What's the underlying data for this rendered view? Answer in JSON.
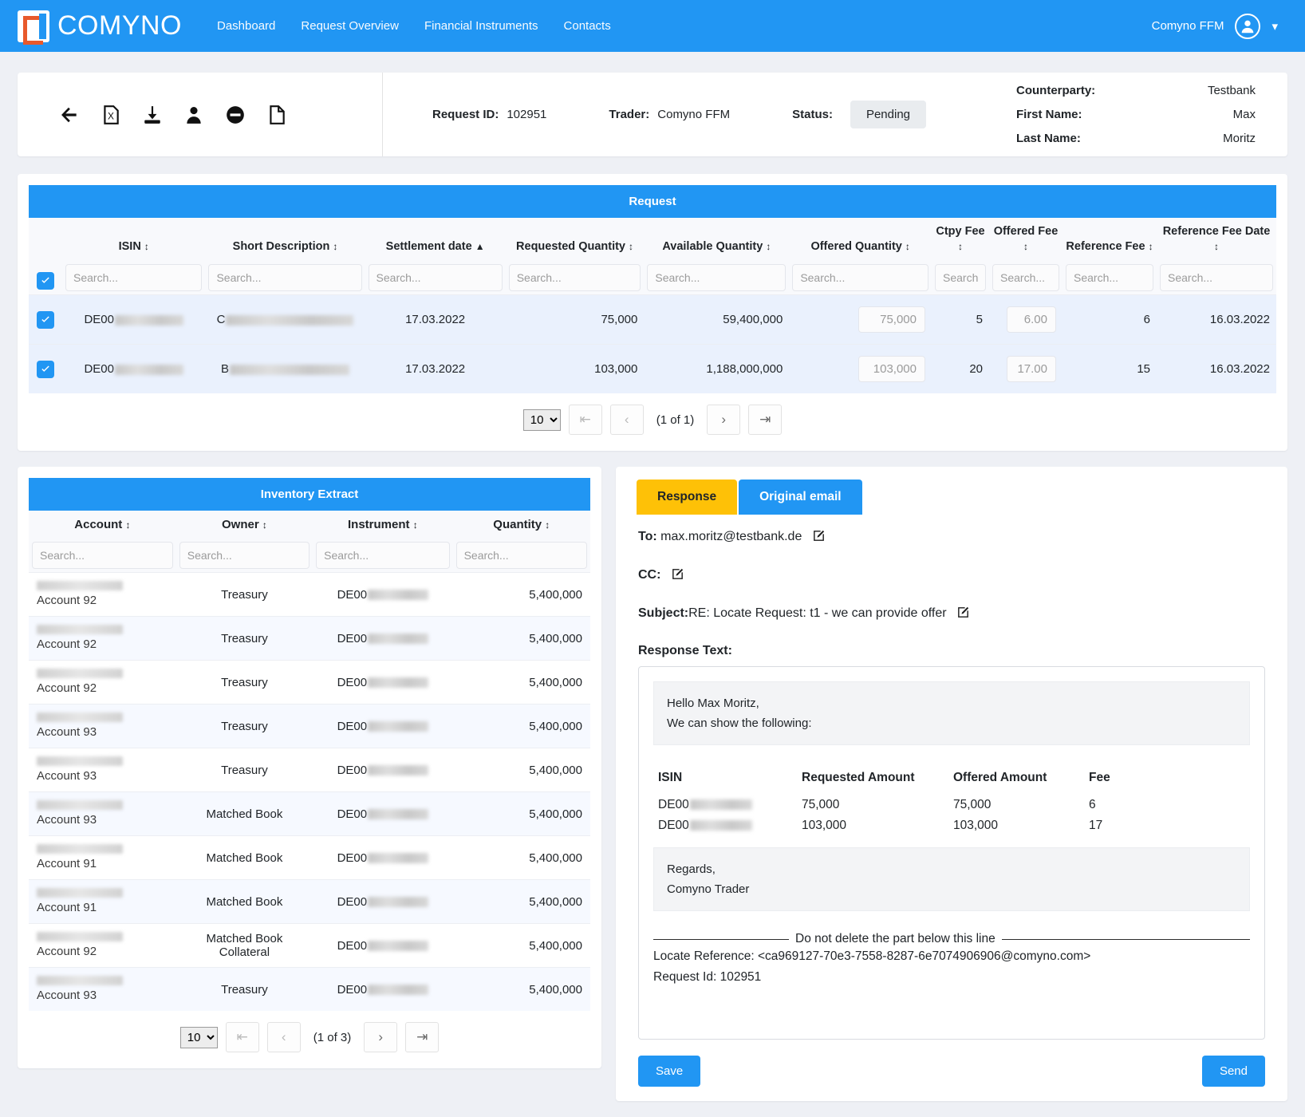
{
  "nav": {
    "brand": "COMYNO",
    "links": [
      "Dashboard",
      "Request Overview",
      "Financial Instruments",
      "Contacts"
    ],
    "user": "Comyno FFM"
  },
  "toolbar": {
    "icons": [
      "back-arrow-icon",
      "excel-file-icon",
      "download-icon",
      "person-icon",
      "block-circle-icon",
      "blank-page-icon"
    ]
  },
  "header": {
    "request_id_label": "Request ID:",
    "request_id_value": "102951",
    "trader_label": "Trader:",
    "trader_value": "Comyno FFM",
    "status_label": "Status:",
    "status_value": "Pending",
    "counterparty_label": "Counterparty:",
    "counterparty_value": "Testbank",
    "first_name_label": "First Name:",
    "first_name_value": "Max",
    "last_name_label": "Last Name:",
    "last_name_value": "Moritz"
  },
  "request": {
    "title": "Request",
    "columns": [
      "ISIN",
      "Short Description",
      "Settlement date",
      "Requested Quantity",
      "Available Quantity",
      "Offered Quantity",
      "Ctpy Fee",
      "Offered Fee",
      "Reference Fee",
      "Reference Fee Date"
    ],
    "search_placeholder": "Search...",
    "rows": [
      {
        "isin": "DE00",
        "short_description": "C",
        "settlement_date": "17.03.2022",
        "requested_quantity": "75,000",
        "available_quantity": "59,400,000",
        "offered_quantity": "75,000",
        "ctpy_fee": "5",
        "offered_fee": "6.00",
        "reference_fee": "6",
        "reference_fee_date": "16.03.2022"
      },
      {
        "isin": "DE00",
        "short_description": "B",
        "settlement_date": "17.03.2022",
        "requested_quantity": "103,000",
        "available_quantity": "1,188,000,000",
        "offered_quantity": "103,000",
        "ctpy_fee": "20",
        "offered_fee": "17.00",
        "reference_fee": "15",
        "reference_fee_date": "16.03.2022"
      }
    ],
    "pager": {
      "page_size": "10",
      "count": "(1 of 1)"
    }
  },
  "inventory": {
    "title": "Inventory Extract",
    "columns": [
      "Account",
      "Owner",
      "Instrument",
      "Quantity"
    ],
    "search_placeholder": "Search...",
    "rows": [
      {
        "account": "Account 92",
        "owner": "Treasury",
        "instrument": "DE00",
        "quantity": "5,400,000"
      },
      {
        "account": "Account 92",
        "owner": "Treasury",
        "instrument": "DE00",
        "quantity": "5,400,000"
      },
      {
        "account": "Account 92",
        "owner": "Treasury",
        "instrument": "DE00",
        "quantity": "5,400,000"
      },
      {
        "account": "Account 93",
        "owner": "Treasury",
        "instrument": "DE00",
        "quantity": "5,400,000"
      },
      {
        "account": "Account 93",
        "owner": "Treasury",
        "instrument": "DE00",
        "quantity": "5,400,000"
      },
      {
        "account": "Account 93",
        "owner": "Matched Book",
        "instrument": "DE00",
        "quantity": "5,400,000"
      },
      {
        "account": "Account 91",
        "owner": "Matched Book",
        "instrument": "DE00",
        "quantity": "5,400,000"
      },
      {
        "account": "Account 91",
        "owner": "Matched Book",
        "instrument": "DE00",
        "quantity": "5,400,000"
      },
      {
        "account": "Account 92",
        "owner": "Matched Book Collateral",
        "instrument": "DE00",
        "quantity": "5,400,000"
      },
      {
        "account": "Account 93",
        "owner": "Treasury",
        "instrument": "DE00",
        "quantity": "5,400,000"
      }
    ],
    "pager": {
      "page_size": "10",
      "count": "(1 of 3)"
    }
  },
  "response": {
    "tab_response": "Response",
    "tab_original": "Original email",
    "to_label": "To:",
    "to_value": "max.moritz@testbank.de",
    "cc_label": "CC:",
    "cc_value": "",
    "subject_label": "Subject:",
    "subject_value": "RE: Locate Request: t1 - we can provide offer",
    "response_text_label": "Response Text:",
    "greeting_line1": "Hello Max Moritz,",
    "greeting_line2": "We can show the following:",
    "table_headers": [
      "ISIN",
      "Requested Amount",
      "Offered Amount",
      "Fee"
    ],
    "table_rows": [
      {
        "isin": "DE00",
        "requested": "75,000",
        "offered": "75,000",
        "fee": "6"
      },
      {
        "isin": "DE00",
        "requested": "103,000",
        "offered": "103,000",
        "fee": "17"
      }
    ],
    "sign_line1": "Regards,",
    "sign_line2": "Comyno Trader",
    "divider_text": "Do not delete the part below this line",
    "locate_reference": "Locate Reference: <ca969127-70e3-7558-8287-6e7074906906@comyno.com>",
    "request_id_line": "Request Id: 102951",
    "save_label": "Save",
    "send_label": "Send"
  },
  "colors": {
    "brand_blue": "#2196f3",
    "accent_yellow": "#fec107",
    "row_highlight": "#eaf1fd"
  }
}
